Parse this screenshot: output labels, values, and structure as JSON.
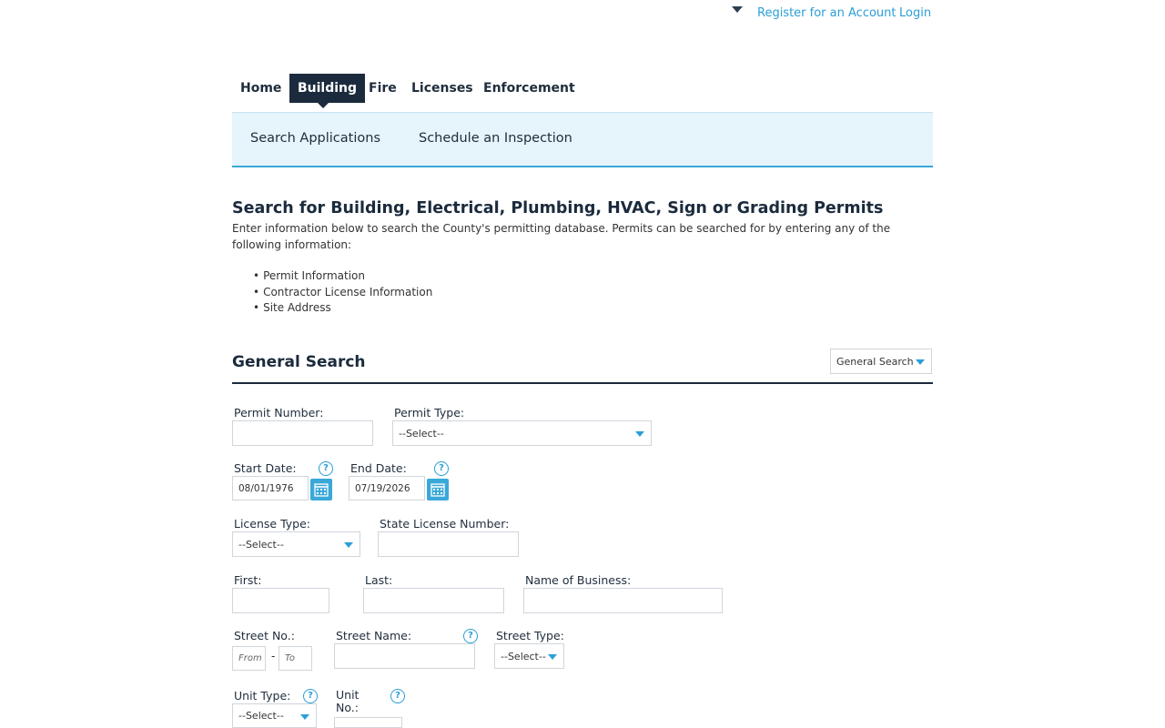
{
  "header": {
    "register_link": "Register for an Account",
    "login_link": "Login"
  },
  "nav": {
    "tabs": [
      {
        "label": "Home"
      },
      {
        "label": "Building"
      },
      {
        "label": "Fire"
      },
      {
        "label": "Licenses"
      },
      {
        "label": "Enforcement"
      }
    ],
    "active": "Building"
  },
  "subnav": {
    "items": [
      {
        "label": "Search Applications"
      },
      {
        "label": "Schedule an Inspection"
      }
    ]
  },
  "page": {
    "title": "Search for Building, Electrical, Plumbing, HVAC, Sign or Grading Permits",
    "intro": "Enter information below to search the County's permitting database. Permits can be searched for by entering any of the following information:",
    "bullets": [
      "Permit Information",
      "Contractor License Information",
      "Site Address"
    ]
  },
  "search": {
    "section_title": "General Search",
    "search_type_value": "General Search",
    "permit_number_label": "Permit Number:",
    "permit_number_value": "",
    "permit_type_label": "Permit Type:",
    "permit_type_value": "--Select--",
    "start_date_label": "Start Date:",
    "start_date_value": "08/01/1976",
    "end_date_label": "End Date:",
    "end_date_value": "07/19/2026",
    "license_type_label": "License Type:",
    "license_type_value": "--Select--",
    "state_license_label": "State License Number:",
    "state_license_value": "",
    "first_label": "First:",
    "last_label": "Last:",
    "business_label": "Name of Business:",
    "street_no_label": "Street No.:",
    "street_no_from_placeholder": "From",
    "street_no_to_placeholder": "To",
    "street_no_separator": "-",
    "street_name_label": "Street Name:",
    "street_type_label": "Street Type:",
    "street_type_value": "--Select--",
    "unit_type_label": "Unit Type:",
    "unit_type_value": "--Select--",
    "unit_no_label_line1": "Unit",
    "unit_no_label_line2": "No.:",
    "help_glyph": "?"
  },
  "colors": {
    "nav_active_bg": "#1b2b3d",
    "link_blue": "#2a9fd6",
    "subnav_bg": "#e6f4fb",
    "calendar_blue": "#3aa8d8"
  }
}
